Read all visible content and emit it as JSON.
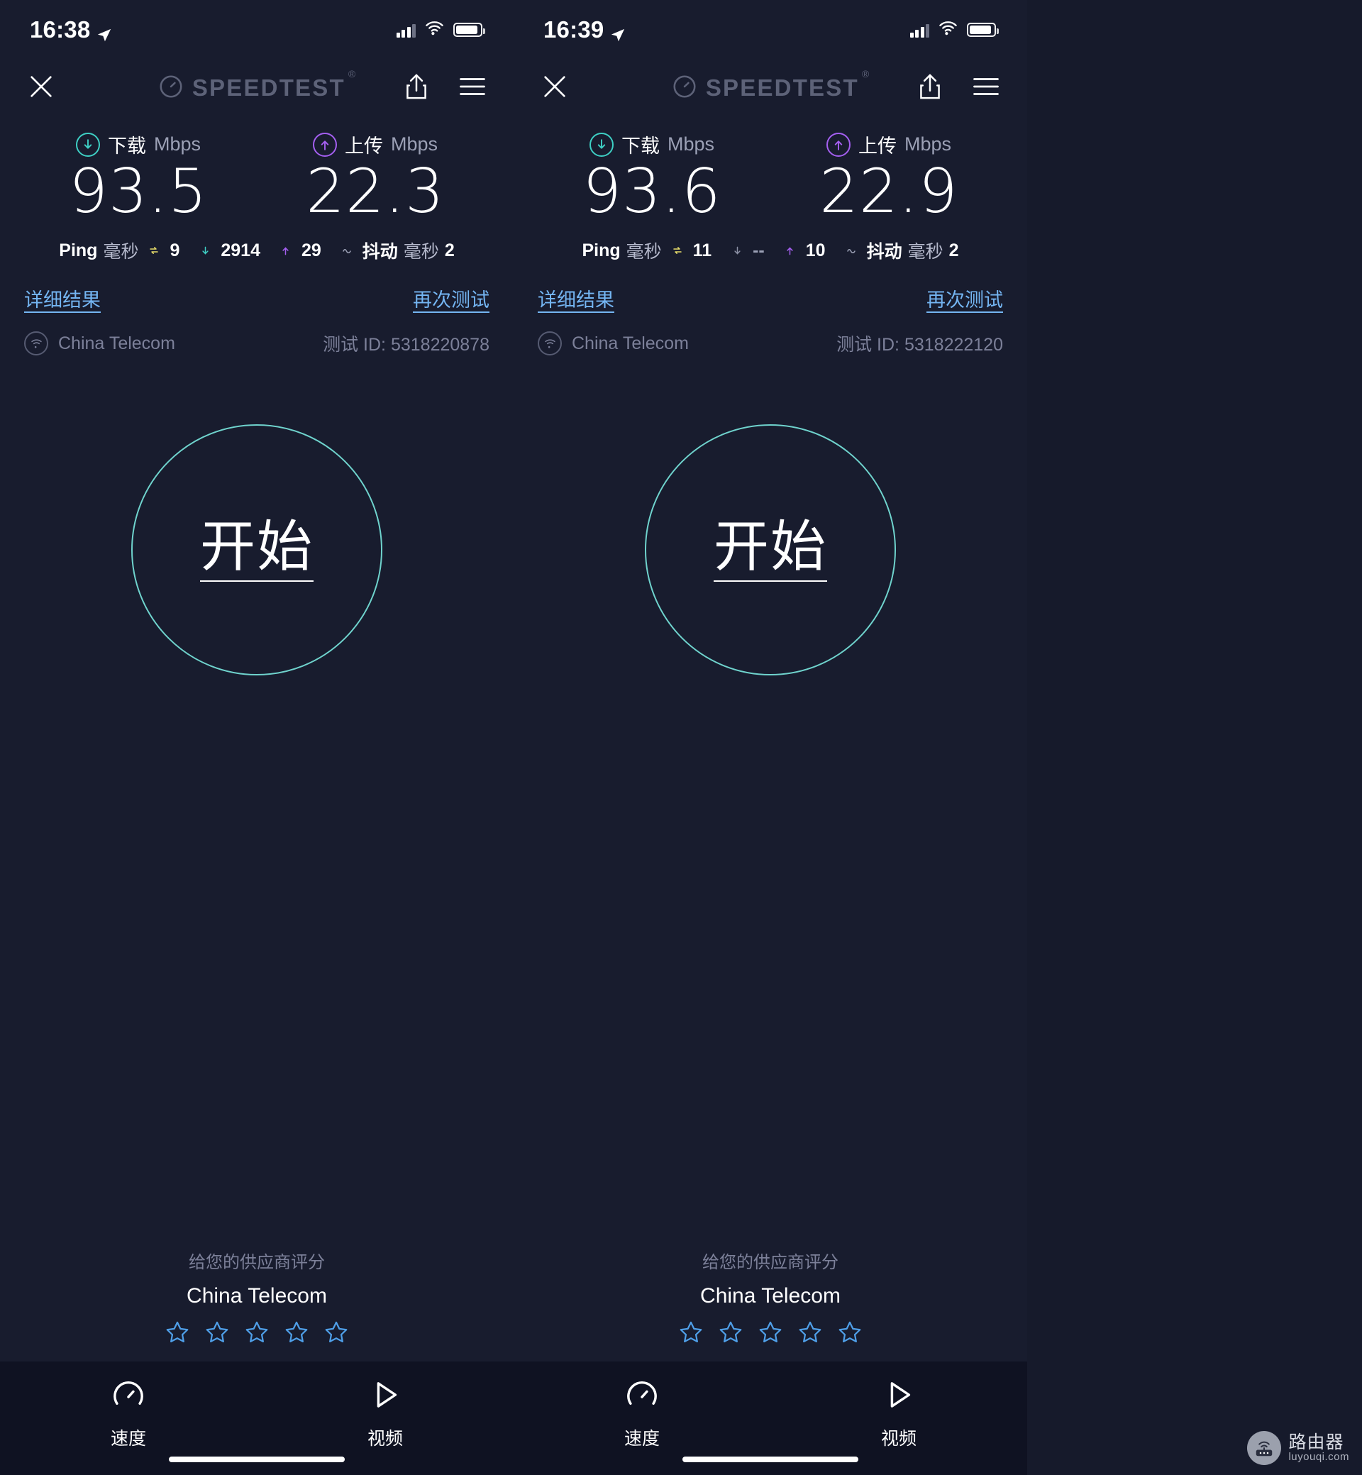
{
  "panels": [
    {
      "status": {
        "time": "16:38",
        "location_icon": "location-arrow-icon"
      },
      "header": {
        "close_icon": "close-icon",
        "brand": "SPEEDTEST",
        "brand_mark": "®",
        "share_icon": "share-icon",
        "menu_icon": "hamburger-menu-icon"
      },
      "download": {
        "label": "下载",
        "unit": "Mbps",
        "value": "93.5",
        "icon": "download-arrow-icon"
      },
      "upload": {
        "label": "上传",
        "unit": "Mbps",
        "value": "22.3",
        "icon": "upload-arrow-icon"
      },
      "ping": {
        "title": "Ping",
        "unit": "毫秒",
        "idle": "9",
        "download": "2914",
        "upload": "29",
        "idle_icon": "exchange-icon",
        "download_icon": "download-arrow-icon",
        "upload_icon": "upload-arrow-icon"
      },
      "jitter": {
        "icon": "jitter-wave-icon",
        "label": "抖动",
        "unit": "毫秒",
        "value": "2"
      },
      "detail_link": "详细结果",
      "retest_link": "再次测试",
      "isp": "China Telecom",
      "test_id_label": "测试 ID:",
      "test_id": "5318220878",
      "go_label": "开始",
      "rating": {
        "title": "给您的供应商评分",
        "isp": "China Telecom",
        "stars": 5,
        "filled": 0
      },
      "tabs": [
        {
          "label": "速度",
          "icon": "speedometer-icon",
          "active": true
        },
        {
          "label": "视频",
          "icon": "play-triangle-icon",
          "active": false
        }
      ]
    },
    {
      "status": {
        "time": "16:39",
        "location_icon": "location-arrow-icon"
      },
      "header": {
        "close_icon": "close-icon",
        "brand": "SPEEDTEST",
        "brand_mark": "®",
        "share_icon": "share-icon",
        "menu_icon": "hamburger-menu-icon"
      },
      "download": {
        "label": "下载",
        "unit": "Mbps",
        "value": "93.6",
        "icon": "download-arrow-icon"
      },
      "upload": {
        "label": "上传",
        "unit": "Mbps",
        "value": "22.9",
        "icon": "upload-arrow-icon"
      },
      "ping": {
        "title": "Ping",
        "unit": "毫秒",
        "idle": "11",
        "download": "--",
        "upload": "10",
        "idle_icon": "exchange-icon",
        "download_icon": "download-arrow-icon",
        "upload_icon": "upload-arrow-icon"
      },
      "jitter": {
        "icon": "jitter-wave-icon",
        "label": "抖动",
        "unit": "毫秒",
        "value": "2"
      },
      "detail_link": "详细结果",
      "retest_link": "再次测试",
      "isp": "China Telecom",
      "test_id_label": "测试 ID:",
      "test_id": "5318222120",
      "go_label": "开始",
      "rating": {
        "title": "给您的供应商评分",
        "isp": "China Telecom",
        "stars": 5,
        "filled": 0
      },
      "tabs": [
        {
          "label": "速度",
          "icon": "speedometer-icon",
          "active": true
        },
        {
          "label": "视频",
          "icon": "play-triangle-icon",
          "active": false
        }
      ]
    }
  ],
  "watermark": {
    "cn": "路由器",
    "en": "luyouqi.com",
    "icon": "router-icon"
  },
  "colors": {
    "background": "#181c2e",
    "tabbar": "#0f1222",
    "download_accent": "#3ecfc4",
    "upload_accent": "#a45ff0",
    "idle_accent": "#e7dd6a",
    "link": "#74b5f2",
    "star": "#4f9fe8",
    "go_ring": "#6fd3cd",
    "muted_text": "#7c8099"
  }
}
